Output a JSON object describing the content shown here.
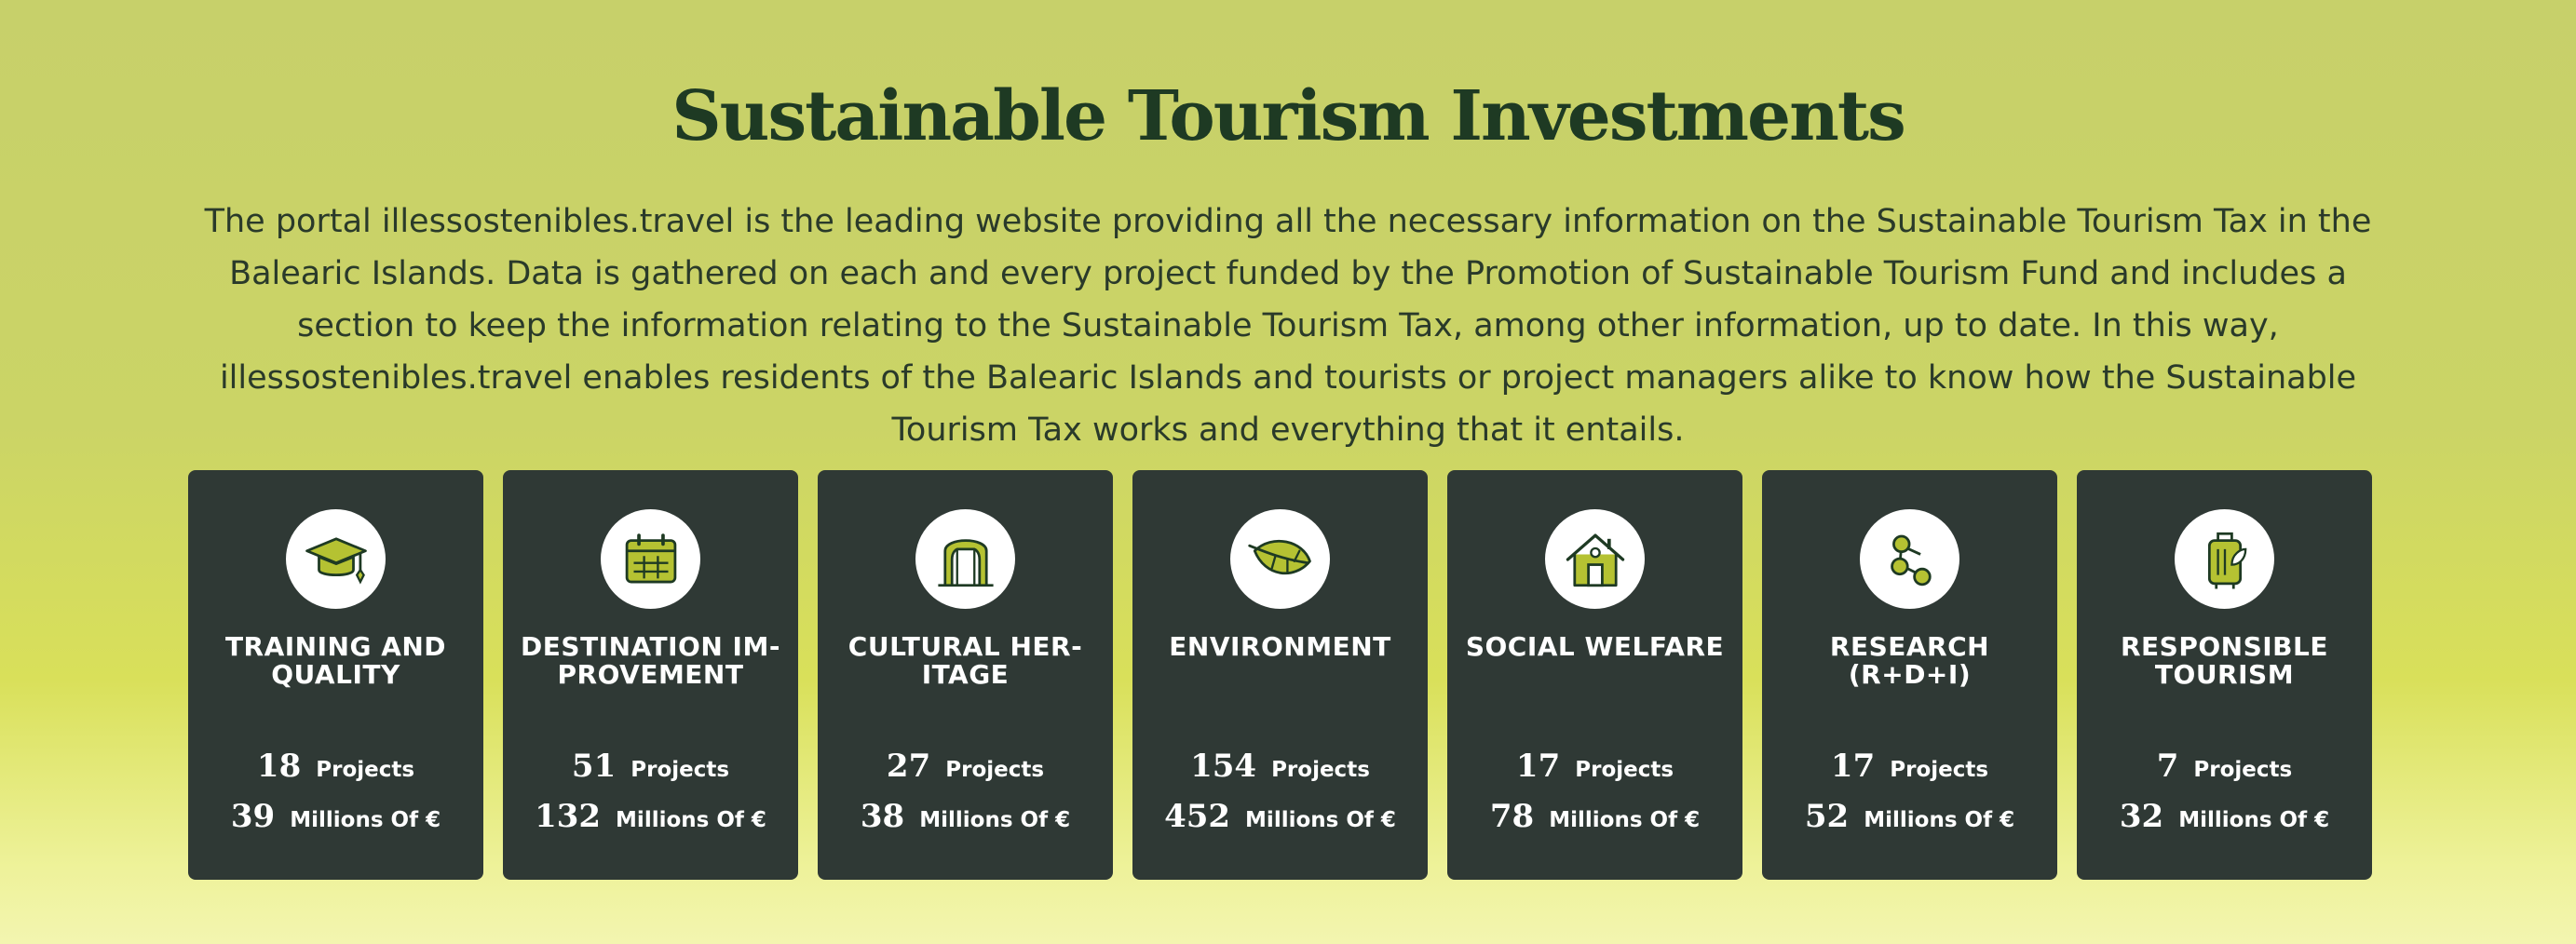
{
  "header": {
    "title": "Sustainable Tourism Investments",
    "intro": "The portal illessostenibles.travel is the leading website providing all the necessary information on the Sustainable Tourism Tax in the Balearic Islands. Data is gathered on each and every project funded by the Promotion of Sustainable Tourism Fund and includes a section to keep the information relating to the Sustainable Tourism Tax, among other information, up to date. In this way, illessostenibles.travel enables residents of the Balearic Islands and tourists or project managers alike to know how the Sustainable Tourism Tax works and everything that it entails."
  },
  "labels": {
    "projects": "Projects",
    "millions": "Millions Of €"
  },
  "colors": {
    "background": "#c7d06a",
    "card": "#2f3935",
    "accent": "#b5c232",
    "title": "#1e3a23"
  },
  "cards": [
    {
      "title": "TRAINING AND QUALITY",
      "icon": "graduation-cap-icon",
      "projects": "18",
      "millions": "39"
    },
    {
      "title": "DESTINATION IM-PROVEMENT",
      "icon": "calendar-icon",
      "projects": "51",
      "millions": "132"
    },
    {
      "title": "CULTURAL HER-ITAGE",
      "icon": "monument-icon",
      "projects": "27",
      "millions": "38"
    },
    {
      "title": "ENVIRONMENT",
      "icon": "leaf-icon",
      "projects": "154",
      "millions": "452"
    },
    {
      "title": "SOCIAL WELFARE",
      "icon": "house-icon",
      "projects": "17",
      "millions": "78"
    },
    {
      "title": "RESEARCH (R+D+I)",
      "icon": "network-icon",
      "projects": "17",
      "millions": "52"
    },
    {
      "title": "RESPONSIBLE TOURISM",
      "icon": "suitcase-icon",
      "projects": "7",
      "millions": "32"
    }
  ]
}
